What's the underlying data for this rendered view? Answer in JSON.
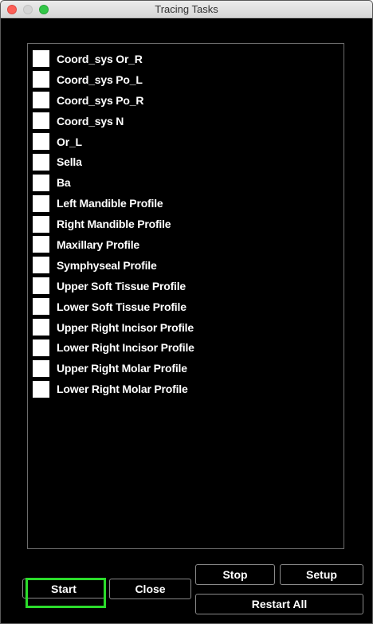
{
  "window": {
    "title": "Tracing Tasks"
  },
  "tasks": [
    {
      "label": "Coord_sys Or_R",
      "checked": false
    },
    {
      "label": "Coord_sys Po_L",
      "checked": false
    },
    {
      "label": "Coord_sys Po_R",
      "checked": false
    },
    {
      "label": "Coord_sys N",
      "checked": false
    },
    {
      "label": "Or_L",
      "checked": false
    },
    {
      "label": "Sella",
      "checked": false
    },
    {
      "label": "Ba",
      "checked": false
    },
    {
      "label": "Left Mandible Profile",
      "checked": false
    },
    {
      "label": "Right Mandible Profile",
      "checked": false
    },
    {
      "label": "Maxillary Profile",
      "checked": false
    },
    {
      "label": "Symphyseal Profile",
      "checked": false
    },
    {
      "label": "Upper Soft Tissue Profile",
      "checked": false
    },
    {
      "label": "Lower Soft Tissue Profile",
      "checked": false
    },
    {
      "label": "Upper Right Incisor Profile",
      "checked": false
    },
    {
      "label": "Lower Right Incisor Profile",
      "checked": false
    },
    {
      "label": "Upper Right Molar Profile",
      "checked": false
    },
    {
      "label": "Lower Right Molar Profile",
      "checked": false
    }
  ],
  "buttons": {
    "start": "Start",
    "close": "Close",
    "stop": "Stop",
    "setup": "Setup",
    "restart_all": "Restart All"
  },
  "colors": {
    "background": "#000000",
    "highlight": "#2bdc2b",
    "close_light": "#fc5f57",
    "minimize_light": "#d5d5d5",
    "maximize_light": "#33c748"
  }
}
